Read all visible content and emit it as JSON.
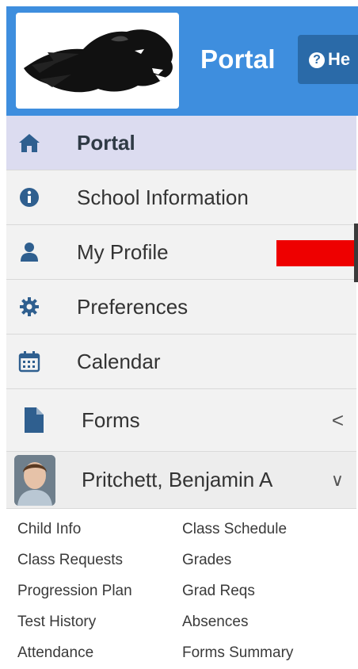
{
  "header": {
    "title": "Portal",
    "help_label": "He",
    "accent_color": "#3e8ede"
  },
  "nav": {
    "items": [
      {
        "label": "Portal",
        "icon": "home-icon",
        "active": true
      },
      {
        "label": "School Information",
        "icon": "info-circle-icon"
      },
      {
        "label": "My Profile",
        "icon": "user-icon"
      },
      {
        "label": "Preferences",
        "icon": "gear-icon"
      },
      {
        "label": "Calendar",
        "icon": "calendar-icon"
      },
      {
        "label": "Forms",
        "icon": "file-icon",
        "chevron": "<"
      }
    ],
    "student": {
      "name": "Pritchett, Benjamin A",
      "chevron": "∨"
    }
  },
  "student_links": {
    "left": [
      "Child Info",
      "Class Requests",
      "Progression Plan",
      "Test History",
      "Attendance"
    ],
    "right": [
      "Class Schedule",
      "Grades",
      "Grad Reqs",
      "Absences",
      "Forms Summary"
    ]
  }
}
